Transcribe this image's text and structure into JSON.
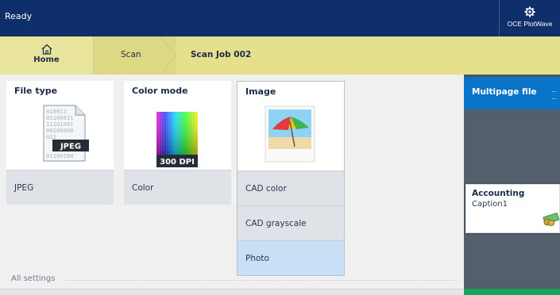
{
  "topbar": {
    "status": "Ready",
    "device_name": "OCE PlotWave"
  },
  "breadcrumb": {
    "home_label": "Home",
    "scan_label": "Scan",
    "job_label": "Scan Job 002"
  },
  "tiles": {
    "file_type": {
      "title": "File type",
      "badge": "JPEG",
      "bits": [
        "010011",
        "01100011",
        "11101001",
        "00100000",
        "011",
        "01100100"
      ],
      "value": "JPEG"
    },
    "color_mode": {
      "title": "Color mode",
      "badge": "300 DPI",
      "value": "Color"
    },
    "image": {
      "title": "Image",
      "options": [
        "CAD color",
        "CAD grayscale",
        "Photo"
      ],
      "selected": "Photo"
    }
  },
  "footer": {
    "all_settings": "All settings"
  },
  "right_panel": {
    "multipage": "Multipage file",
    "accounting_title": "Accounting",
    "accounting_caption": "Caption1"
  },
  "colors": {
    "topbar": "#0f2f6b",
    "breadcrumb": "#e4e08c",
    "selected_option": "#c8e0f6",
    "accent_blue": "#0a74c9",
    "right_panel": "#4a5362",
    "green_strip": "#1aa35a"
  },
  "icons": [
    "gear-icon",
    "home-icon",
    "jpeg-file-icon",
    "color-grid-icon",
    "beach-photo-icon",
    "money-icon"
  ]
}
